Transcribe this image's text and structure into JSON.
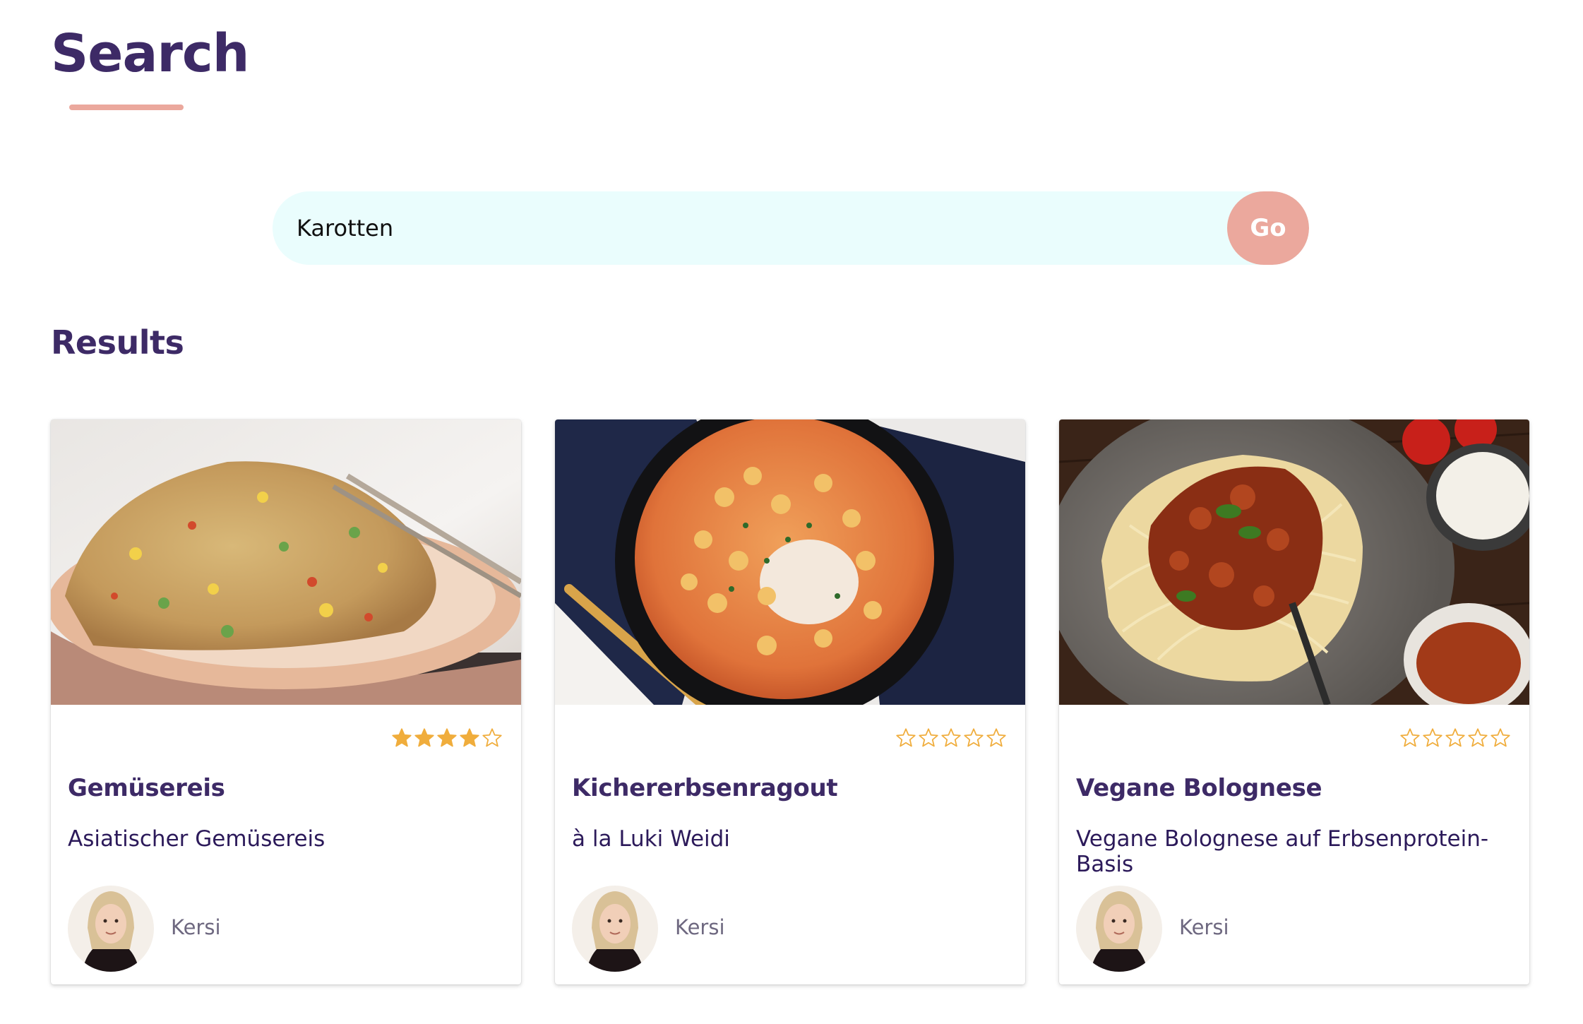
{
  "header": {
    "title": "Search"
  },
  "search": {
    "value": "Karotten",
    "button_label": "Go"
  },
  "results": {
    "heading": "Results",
    "cards": [
      {
        "title": "Gemüsereis",
        "subtitle": "Asiatischer Gemüsereis",
        "author": "Kersi",
        "rating": 4,
        "rating_max": 5
      },
      {
        "title": "Kichererbsenragout",
        "subtitle": "à la Luki Weidi",
        "author": "Kersi",
        "rating": 0,
        "rating_max": 5
      },
      {
        "title": "Vegane Bolognese",
        "subtitle": "Vegane Bolognese auf Erbsenprotein-Basis",
        "author": "Kersi",
        "rating": 0,
        "rating_max": 5
      }
    ]
  },
  "colors": {
    "heading": "#3d2a66",
    "accent": "#eba89d",
    "search_background": "#eafdfd",
    "star": "#f0ad3c"
  },
  "icons": {
    "star_filled": "star-filled-icon",
    "star_empty": "star-empty-icon"
  }
}
